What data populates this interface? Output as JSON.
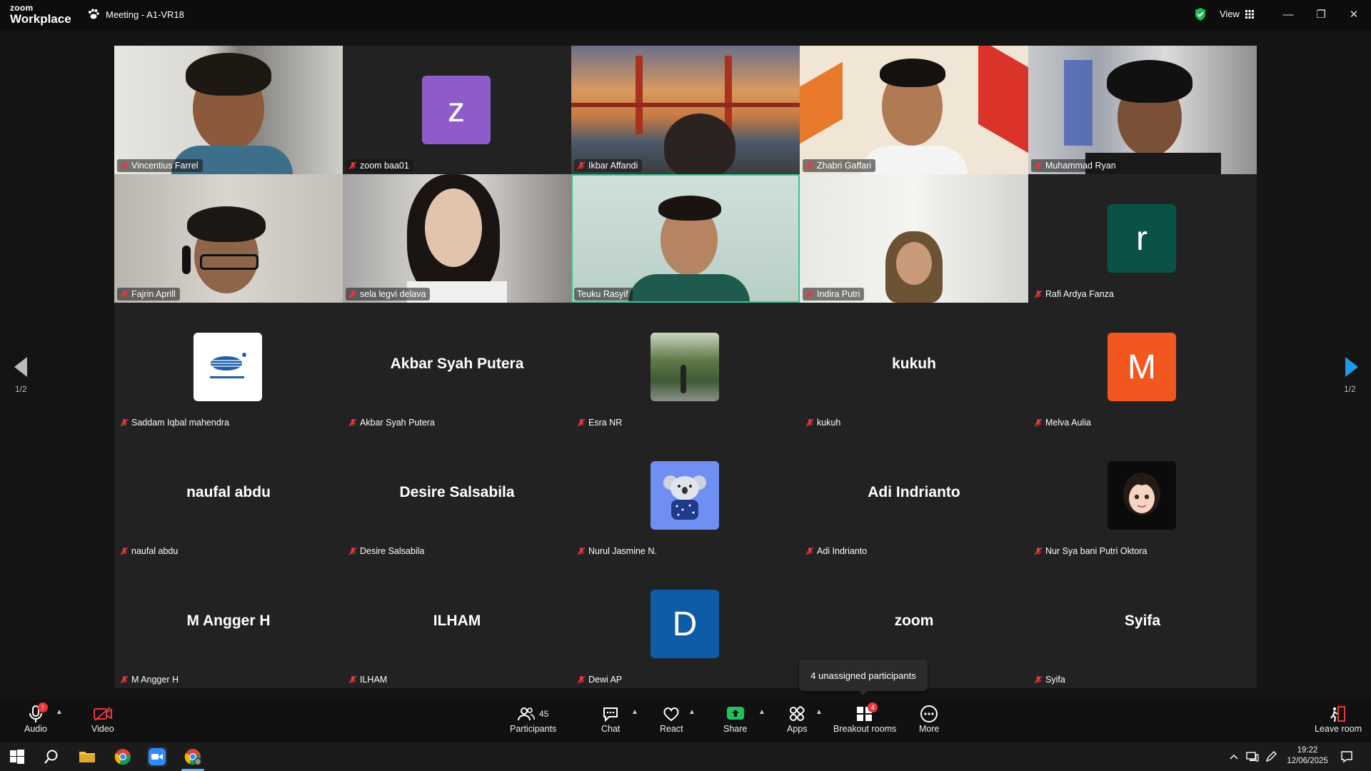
{
  "app": {
    "logo_line1": "zoom",
    "logo_line2": "Workplace",
    "meeting_title": "Meeting - A1-VR18",
    "view_label": "View"
  },
  "gallery": {
    "tiles": [
      {
        "name": "Vincentius Farrel"
      },
      {
        "name": "zoom baa01",
        "avatar_letter": "z",
        "avatar_color": "#8e5cc9"
      },
      {
        "name": "Ikbar Affandi"
      },
      {
        "name": "Zhabri Gaffari"
      },
      {
        "name": "Muhammad Ryan"
      },
      {
        "name": "Fajrin Aprill"
      },
      {
        "name": "sela legvi delava"
      },
      {
        "name": "Teuku Rasyif",
        "active": true
      },
      {
        "name": "Indira Putri"
      },
      {
        "name": "Rafi Ardya Fanza",
        "avatar_letter": "r",
        "avatar_color": "#0a5247"
      },
      {
        "name": "Saddam Iqbal mahendra"
      },
      {
        "name": "Akbar Syah Putera",
        "display_text": "Akbar Syah Putera"
      },
      {
        "name": "Esra NR"
      },
      {
        "name": "kukuh",
        "display_text": "kukuh"
      },
      {
        "name": "Melva Aulia",
        "avatar_letter": "M",
        "avatar_color": "#f2571f"
      },
      {
        "name": "naufal abdu",
        "display_text": "naufal abdu"
      },
      {
        "name": "Desire Salsabila",
        "display_text": "Desire Salsabila"
      },
      {
        "name": "Nurul Jasmine N."
      },
      {
        "name": "Adi Indrianto",
        "display_text": "Adi Indrianto"
      },
      {
        "name": "Nur Sya bani Putri Oktora"
      },
      {
        "name": "M Angger H",
        "display_text": "M Angger H"
      },
      {
        "name": "ILHAM",
        "display_text": "ILHAM"
      },
      {
        "name": "Dewi AP",
        "avatar_letter": "D",
        "avatar_color": "#0e5ba8"
      },
      {
        "name": "",
        "display_text": "zoom"
      },
      {
        "name": "Syifa",
        "display_text": "Syifa"
      }
    ],
    "page_indicator_left": "1/2",
    "page_indicator_right": "1/2",
    "tooltip": "4 unassigned participants"
  },
  "toolbar": {
    "audio": "Audio",
    "video": "Video",
    "participants": "Participants",
    "participants_count": "45",
    "chat": "Chat",
    "react": "React",
    "share": "Share",
    "apps": "Apps",
    "breakout": "Breakout rooms",
    "breakout_badge": "4",
    "more": "More",
    "leave": "Leave room"
  },
  "taskbar": {
    "time": "19:22",
    "date": "12/06/2025"
  },
  "colors": {
    "mute_red": "#e8383d",
    "share_green": "#1fc25b",
    "active_border": "#3ec28f",
    "shield_green": "#1db954"
  }
}
